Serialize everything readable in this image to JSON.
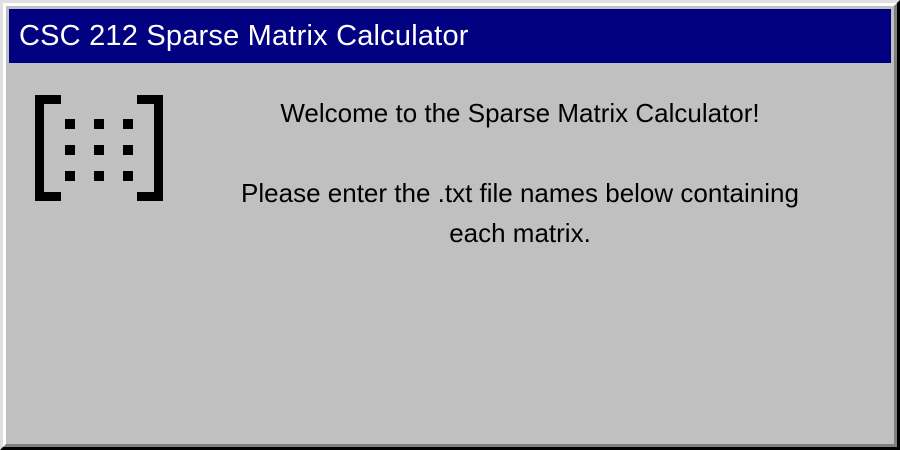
{
  "window": {
    "title": "CSC 212 Sparse Matrix Calculator"
  },
  "icon": {
    "name": "matrix-icon"
  },
  "message": {
    "welcome": "Welcome to the Sparse Matrix Calculator!",
    "instruction": "Please enter the .txt file names below containing each matrix."
  },
  "colors": {
    "title_bar": "#000080",
    "window_bg": "#c0c0c0",
    "title_text": "#ffffff"
  }
}
